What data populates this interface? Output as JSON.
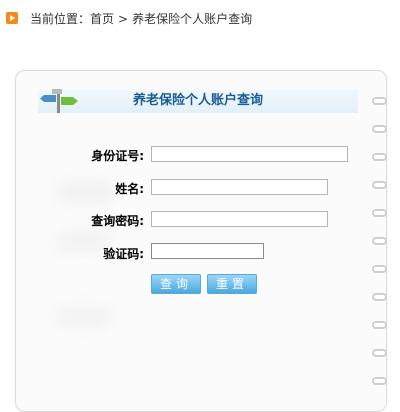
{
  "breadcrumb": {
    "prefix": "当前位置：",
    "home": "首页",
    "separator": ">",
    "current": "养老保险个人账户查询"
  },
  "panel": {
    "title": "养老保险个人账户查询"
  },
  "form": {
    "id_label": "身份证号:",
    "id_value": "",
    "name_label": "姓名:",
    "name_value": "",
    "password_label": "查询密码:",
    "password_value": "",
    "captcha_label": "验证码:",
    "captcha_value": ""
  },
  "buttons": {
    "query": "查询",
    "reset": "重置"
  },
  "colors": {
    "accent": "#1a5d96",
    "button": "#4aa9e0",
    "breadcrumb_icon": "#f28a1c"
  }
}
